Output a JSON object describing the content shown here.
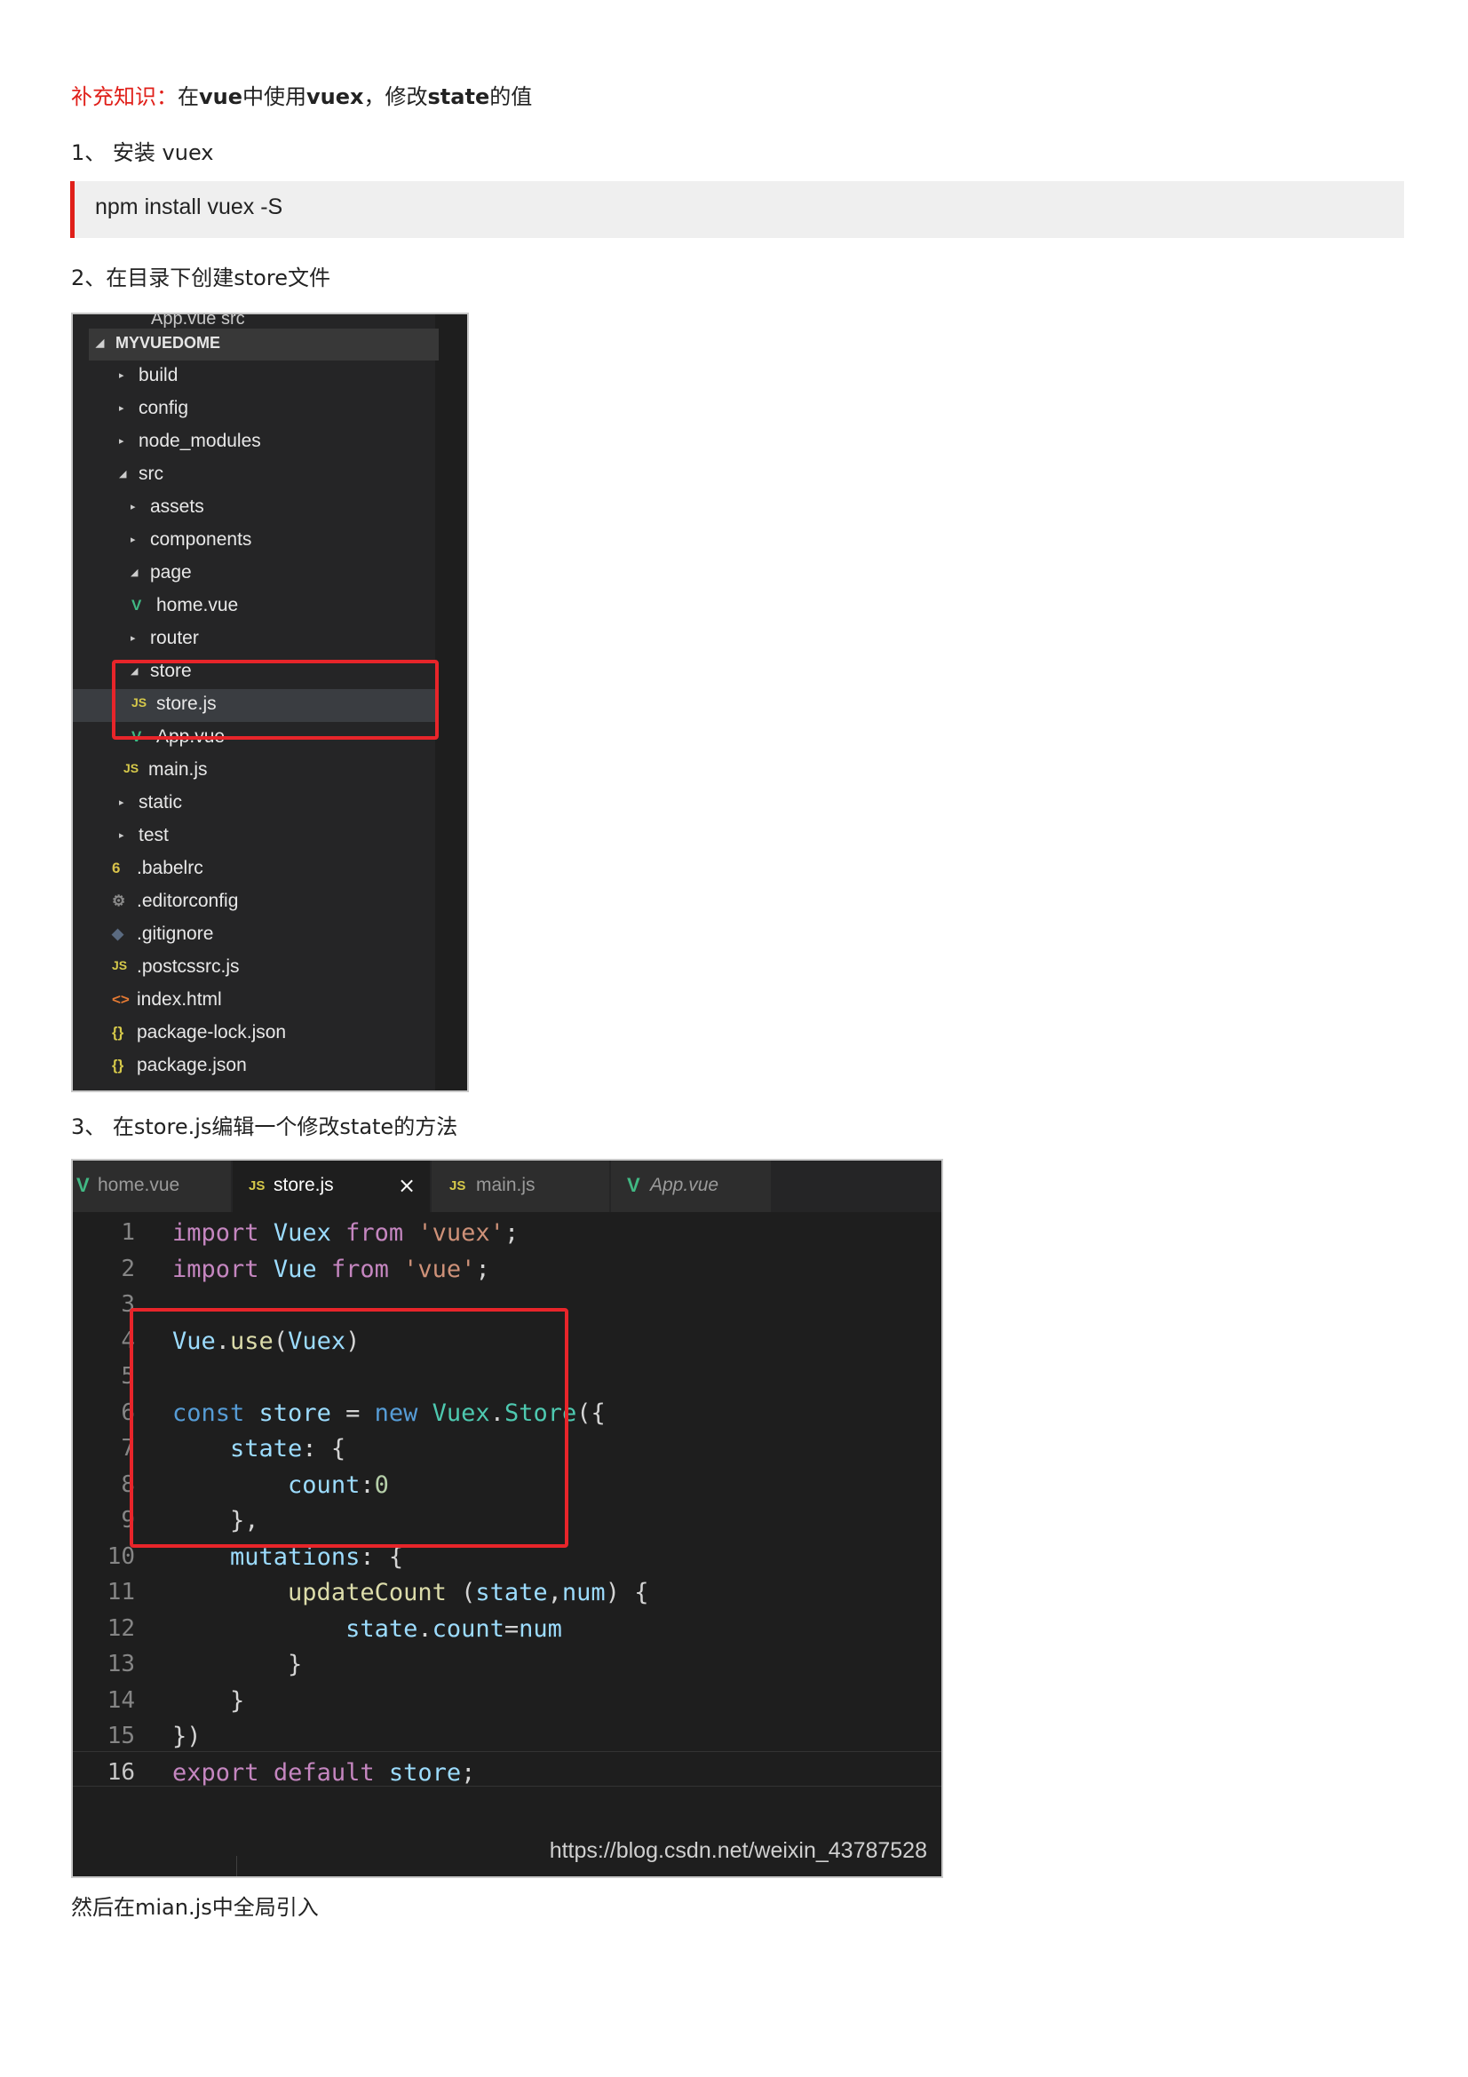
{
  "heading": {
    "prefix": "补充知识：",
    "part1": "在",
    "bold1": "vue",
    "part2": "中使用",
    "bold2": "vuex",
    "part3": "，修改",
    "bold3": "state",
    "part4": "的值"
  },
  "step1": "1、 安装 vuex",
  "install_command": "npm install vuex -S",
  "step2": "2、在目录下创建store文件",
  "explorer": {
    "truncated_top": "App.vue  src",
    "root": "MYVUEDOME",
    "items": [
      {
        "label": "build",
        "icon": "chevron-right",
        "depth": 0
      },
      {
        "label": "config",
        "icon": "chevron-right",
        "depth": 0
      },
      {
        "label": "node_modules",
        "icon": "chevron-right",
        "depth": 0
      },
      {
        "label": "src",
        "icon": "chevron-down",
        "depth": 0
      },
      {
        "label": "assets",
        "icon": "chevron-right",
        "depth": 1
      },
      {
        "label": "components",
        "icon": "chevron-right",
        "depth": 1
      },
      {
        "label": "page",
        "icon": "chevron-down",
        "depth": 1
      },
      {
        "label": "home.vue",
        "icon": "vue-icon",
        "depth": 2
      },
      {
        "label": "router",
        "icon": "chevron-right",
        "depth": 1
      },
      {
        "label": "store",
        "icon": "chevron-down",
        "depth": 1
      },
      {
        "label": "store.js",
        "icon": "js-icon",
        "depth": 2,
        "selected": true
      },
      {
        "label": "App.vue",
        "icon": "vue-icon",
        "depth": 2
      },
      {
        "label": "main.js",
        "icon": "js-icon",
        "depth": 1
      },
      {
        "label": "static",
        "icon": "chevron-right",
        "depth": 0
      },
      {
        "label": "test",
        "icon": "chevron-right",
        "depth": 0
      },
      {
        "label": ".babelrc",
        "icon": "babel-icon",
        "depth": 0
      },
      {
        "label": ".editorconfig",
        "icon": "gear-icon",
        "depth": 0
      },
      {
        "label": ".gitignore",
        "icon": "git-icon",
        "depth": 0
      },
      {
        "label": ".postcssrc.js",
        "icon": "js-icon",
        "depth": 0
      },
      {
        "label": "index.html",
        "icon": "html-icon",
        "depth": 0
      },
      {
        "label": "package-lock.json",
        "icon": "json-icon",
        "depth": 0
      },
      {
        "label": "package.json",
        "icon": "json-icon",
        "depth": 0
      }
    ]
  },
  "step3": "3、 在store.js编辑一个修改state的方法",
  "editor": {
    "tabs": [
      {
        "label": "home.vue",
        "icon": "vue-icon",
        "active": false
      },
      {
        "label": "store.js",
        "icon": "js-icon",
        "active": true,
        "close": "×"
      },
      {
        "label": "main.js",
        "icon": "js-icon",
        "active": false
      },
      {
        "label": "App.vue",
        "icon": "vue-icon",
        "active": false
      }
    ],
    "line_numbers": [
      "1",
      "2",
      "3",
      "4",
      "5",
      "6",
      "7",
      "8",
      "9",
      "10",
      "11",
      "12",
      "13",
      "14",
      "15",
      "16"
    ],
    "watermark": "https://blog.csdn.net/weixin_43787528"
  },
  "footer_text": "然后在mian.js中全局引入",
  "colors": {
    "accent_red": "#e0201a",
    "highlight_red": "#e8252a",
    "editor_bg": "#1e1e1e",
    "explorer_bg": "#252526"
  }
}
